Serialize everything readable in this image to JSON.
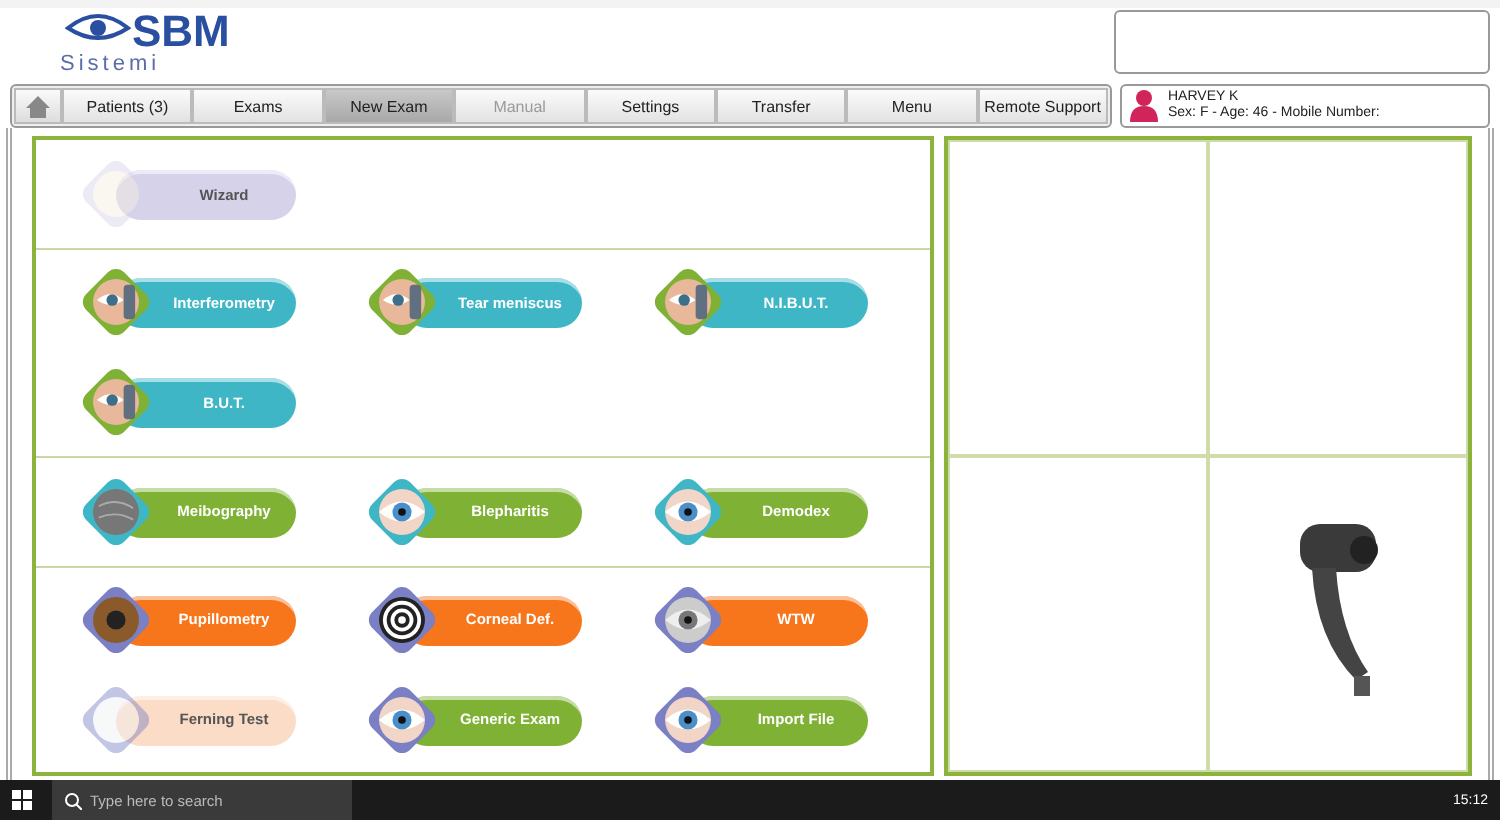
{
  "header": {
    "logo": {
      "name": "SBM",
      "subtitle": "Sistemi"
    }
  },
  "nav": {
    "items": [
      {
        "label": "Patients (3)",
        "selected": false,
        "disabled": false
      },
      {
        "label": "Exams",
        "selected": false,
        "disabled": false
      },
      {
        "label": "New Exam",
        "selected": true,
        "disabled": false
      },
      {
        "label": "Manual",
        "selected": false,
        "disabled": true
      },
      {
        "label": "Settings",
        "selected": false,
        "disabled": false
      },
      {
        "label": "Transfer",
        "selected": false,
        "disabled": false
      },
      {
        "label": "Menu",
        "selected": false,
        "disabled": false
      },
      {
        "label": "Remote Support",
        "selected": false,
        "disabled": false
      }
    ]
  },
  "patient": {
    "name": "HARVEY K",
    "details": "Sex: F - Age: 46 - Mobile Number:"
  },
  "sections": [
    {
      "exams": [
        {
          "label": "Wizard",
          "kind": "wizard",
          "color": "#d6d2ea",
          "disabled": true
        }
      ]
    },
    {
      "exams": [
        {
          "label": "Interferometry",
          "kind": "side-eye",
          "color": "#3fb6c6",
          "disabled": false
        },
        {
          "label": "Tear meniscus",
          "kind": "side-eye",
          "color": "#3fb6c6",
          "disabled": false
        },
        {
          "label": "N.I.B.U.T.",
          "kind": "side-eye",
          "color": "#3fb6c6",
          "disabled": false
        },
        {
          "label": "B.U.T.",
          "kind": "side-eye",
          "color": "#3fb6c6",
          "disabled": false
        }
      ]
    },
    {
      "exams": [
        {
          "label": "Meibography",
          "kind": "gland",
          "color": "#7fb135",
          "disabled": false
        },
        {
          "label": "Blepharitis",
          "kind": "eye",
          "color": "#7fb135",
          "disabled": false
        },
        {
          "label": "Demodex",
          "kind": "eye",
          "color": "#7fb135",
          "disabled": false
        }
      ]
    },
    {
      "exams": [
        {
          "label": "Pupillometry",
          "kind": "pupil",
          "color": "#f7751b",
          "disabled": false
        },
        {
          "label": "Corneal Def.",
          "kind": "rings",
          "color": "#f7751b",
          "disabled": false
        },
        {
          "label": "WTW",
          "kind": "grey-eye",
          "color": "#f7751b",
          "disabled": false
        },
        {
          "label": "Ferning Test",
          "kind": "fern",
          "color": "#fbdcc6",
          "disabled": true
        },
        {
          "label": "Generic Exam",
          "kind": "eye",
          "color": "#7fb135",
          "disabled": false
        },
        {
          "label": "Import File",
          "kind": "eye",
          "color": "#7fb135",
          "disabled": false
        }
      ]
    }
  ],
  "taskbar": {
    "search_placeholder": "Type here to search",
    "time": "15:12"
  }
}
